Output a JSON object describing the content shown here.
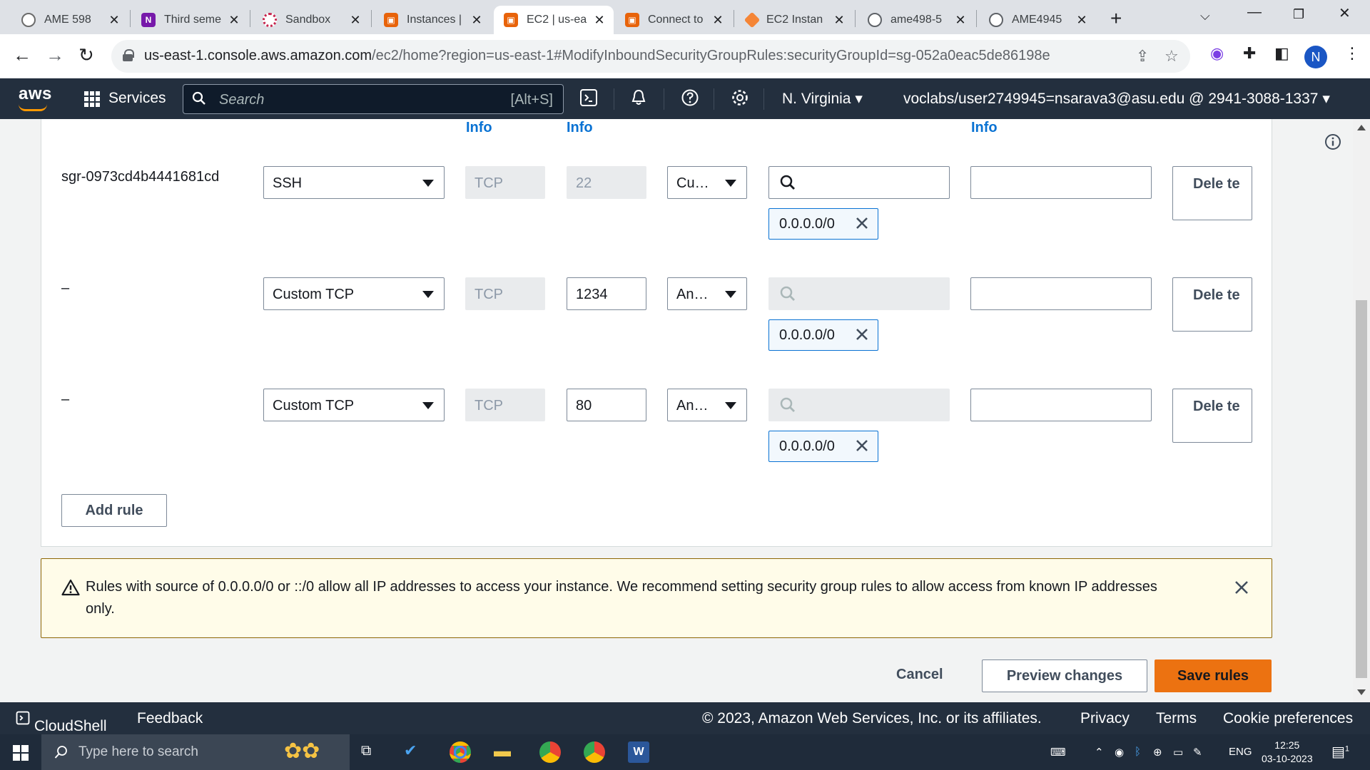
{
  "browser": {
    "tabs": [
      {
        "title": "AME 598",
        "favicon": "chatgpt-icon"
      },
      {
        "title": "Third seme",
        "favicon": "onenote-icon"
      },
      {
        "title": "Sandbox",
        "favicon": "sandbox-icon"
      },
      {
        "title": "Instances |",
        "favicon": "aws-ec2-icon"
      },
      {
        "title": "EC2 | us-ea",
        "favicon": "aws-ec2-icon",
        "active": true
      },
      {
        "title": "Connect to",
        "favicon": "aws-ec2-icon"
      },
      {
        "title": "EC2 Instan",
        "favicon": "aws-box-icon"
      },
      {
        "title": "ame498-5",
        "favicon": "github-icon"
      },
      {
        "title": "AME4945",
        "favicon": "github-icon"
      }
    ],
    "url_host": "us-east-1.console.aws.amazon.com",
    "url_path": "/ec2/home?region=us-east-1#ModifyInboundSecurityGroupRules:securityGroupId=sg-052a0eac5de86198e",
    "profile_initial": "N"
  },
  "awsnav": {
    "logo": "aws",
    "services": "Services",
    "search_placeholder": "Search",
    "search_shortcut": "[Alt+S]",
    "region": "N. Virginia",
    "account": "voclabs/user2749945=nsarava3@asu.edu @ 2941-3088-1337"
  },
  "rules_header": {
    "info_labels": [
      "Info",
      "Info",
      "Info"
    ]
  },
  "rules": [
    {
      "id": "sgr-0973cd4b4441681cd",
      "type": "SSH",
      "protocol": "TCP",
      "port": "22",
      "port_disabled": true,
      "source_type": "Cu…",
      "search_disabled": false,
      "cidr": "0.0.0.0/0",
      "description": "",
      "delete_label": "Dele te"
    },
    {
      "id": "–",
      "type": "Custom TCP",
      "protocol": "TCP",
      "port": "1234",
      "port_disabled": false,
      "source_type": "An…",
      "search_disabled": true,
      "cidr": "0.0.0.0/0",
      "description": "",
      "delete_label": "Dele te"
    },
    {
      "id": "–",
      "type": "Custom TCP",
      "protocol": "TCP",
      "port": "80",
      "port_disabled": false,
      "source_type": "An…",
      "search_disabled": true,
      "cidr": "0.0.0.0/0",
      "description": "",
      "delete_label": "Dele te"
    }
  ],
  "add_rule_label": "Add rule",
  "warning": {
    "text": "Rules with source of 0.0.0.0/0 or ::/0 allow all IP addresses to access your instance. We recommend setting security group rules to allow access from known IP addresses only."
  },
  "actions": {
    "cancel": "Cancel",
    "preview": "Preview changes",
    "save": "Save rules"
  },
  "footer": {
    "cloudshell": "CloudShell",
    "feedback": "Feedback",
    "copyright": "© 2023, Amazon Web Services, Inc. or its affiliates.",
    "privacy": "Privacy",
    "terms": "Terms",
    "cookies": "Cookie preferences"
  },
  "taskbar": {
    "search_placeholder": "Type here to search",
    "lang": "ENG",
    "time": "12:25",
    "date": "03-10-2023",
    "notification_count": "1"
  },
  "colors": {
    "aws_nav": "#232f3e",
    "link_blue": "#0972d3",
    "primary_orange": "#ec7211",
    "warning_bg": "#fffce9"
  }
}
